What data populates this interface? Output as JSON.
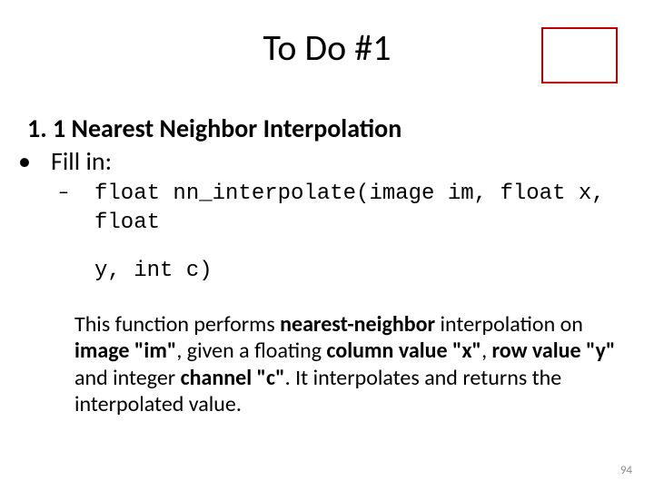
{
  "title": "To Do #1",
  "section": "1. 1 Nearest Neighbor Interpolation",
  "fill_in": "Fill in:",
  "code_line1": "float nn_interpolate(image im, float x, float",
  "code_line2": "y, int c)",
  "desc_parts": {
    "p1": "This function performs ",
    "b1": "nearest-neighbor",
    "p2": " interpolation on ",
    "b2": "image \"im\"",
    "p3": ", given a floating ",
    "b3": "column value \"x\"",
    "p4": ", ",
    "b4": "row value \"y\"",
    "p5": " and integer ",
    "b5": "channel \"c\"",
    "p6": ". It interpolates and returns the interpolated value."
  },
  "page_number": "94"
}
